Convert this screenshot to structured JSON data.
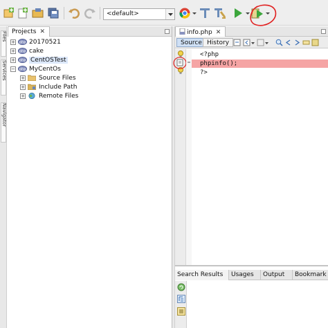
{
  "toolbar": {
    "config_value": "<default>",
    "icons": [
      "new-project-icon",
      "new-file-icon",
      "open-project-icon",
      "save-all-icon",
      "undo-icon",
      "redo-icon",
      "browser-icon",
      "build-icon",
      "clean-build-icon",
      "run-icon",
      "debug-icon"
    ],
    "annotation_color": "#e02020"
  },
  "side_strip": {
    "labels": [
      "Files",
      "Services",
      "Navigator"
    ]
  },
  "projects": {
    "tab_label": "Projects",
    "close_symbol": "✕",
    "tree": [
      {
        "label": "20170521",
        "expander": "+",
        "selected": false
      },
      {
        "label": "cake",
        "expander": "+",
        "selected": false
      },
      {
        "label": "CentOSTest",
        "expander": "+",
        "selected": true
      },
      {
        "label": "MyCentOs",
        "expander": "−",
        "selected": false
      },
      {
        "label": "Source Files",
        "expander": "+",
        "selected": false
      },
      {
        "label": "Include Path",
        "expander": "+",
        "selected": false
      },
      {
        "label": "Remote Files",
        "expander": "+",
        "selected": false
      }
    ]
  },
  "editor": {
    "file_tab": "info.php",
    "file_tab_close": "✕",
    "source_tab": "Source",
    "history_tab": "History",
    "code": [
      {
        "text": "<?php",
        "error": false
      },
      {
        "text": "phpinfo();",
        "error": true
      },
      {
        "text": "?>",
        "error": false
      }
    ]
  },
  "output": {
    "tabs": [
      "Search Results",
      "Usages",
      "Output",
      "Bookmark"
    ]
  }
}
